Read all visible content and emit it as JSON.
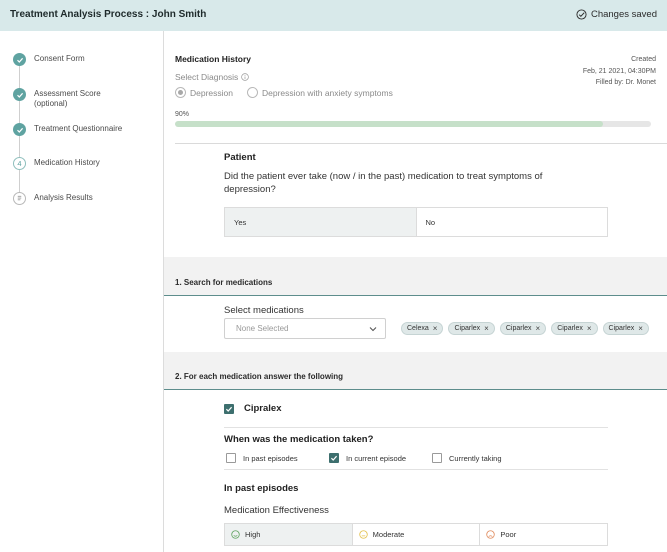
{
  "header": {
    "title": "Treatment Analysis Process : John Smith",
    "saved_label": "Changes saved"
  },
  "steps": [
    {
      "label": "Consent Form",
      "state": "done"
    },
    {
      "label": "Assessment Score (optional)",
      "state": "done"
    },
    {
      "label": "Treatment Questionnaire",
      "state": "done"
    },
    {
      "label": "Medication History",
      "state": "current",
      "number": "4"
    },
    {
      "label": "Analysis Results",
      "state": "pending"
    }
  ],
  "main": {
    "section_title": "Medication History",
    "select_diagnosis_label": "Select Diagnosis",
    "diagnosis_options": [
      {
        "label": "Depression",
        "selected": true
      },
      {
        "label": "Depression with anxiety symptoms",
        "selected": false
      }
    ],
    "created": {
      "label": "Created",
      "date": "Feb, 21 2021, 04:30PM",
      "filled_by": "Filled by: Dr. Monet"
    },
    "progress": {
      "label": "90%",
      "value": 0.9
    },
    "patient": {
      "heading": "Patient",
      "question": "Did the patient ever take (now / in the past) medication to treat symptoms of depression?",
      "options": [
        {
          "label": "Yes",
          "selected": true
        },
        {
          "label": "No",
          "selected": false
        }
      ]
    },
    "search": {
      "section_title": "1. Search for medications",
      "select_label": "Select medications",
      "dropdown_value": "None Selected",
      "chips": [
        "Celexa",
        "Ciparlex",
        "Ciparlex",
        "Ciparlex",
        "Ciparlex"
      ]
    },
    "each": {
      "section_title": "2. For each medication answer the following",
      "medication": "Cipralex",
      "when_question": "When was the medication taken?",
      "timing_options": [
        {
          "label": "In past episodes",
          "checked": false
        },
        {
          "label": "In current episode",
          "checked": true
        },
        {
          "label": "Currently taking",
          "checked": false
        }
      ],
      "in_past_heading": "In past episodes",
      "effectiveness_label": "Medication Effectiveness",
      "effectiveness_options": [
        {
          "label": "High",
          "selected": true,
          "color": "#5fa35f"
        },
        {
          "label": "Moderate",
          "selected": false,
          "color": "#e3c04a"
        },
        {
          "label": "Poor",
          "selected": false,
          "color": "#e08a5c"
        }
      ]
    }
  },
  "colors": {
    "topbar": "#d8e9ea",
    "accent": "#5fa3a1",
    "progress_fill": "#c6e0c9",
    "chip": "#dfe8e8"
  }
}
